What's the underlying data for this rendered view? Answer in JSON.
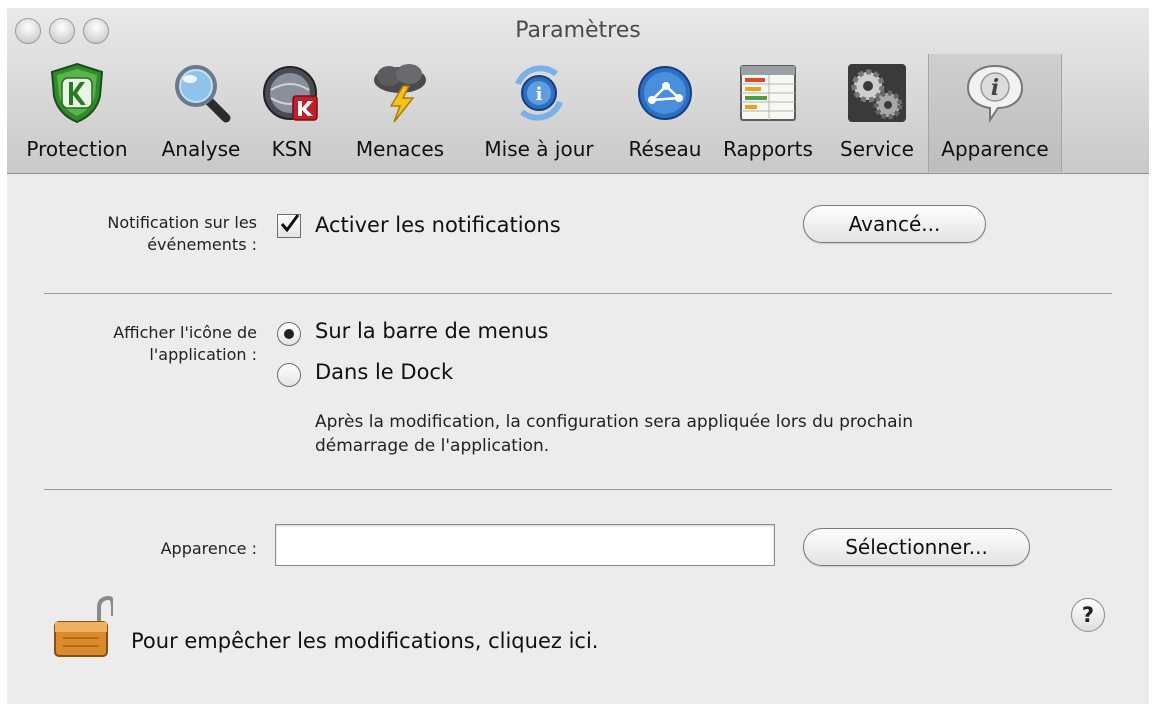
{
  "window": {
    "title": "Paramètres"
  },
  "toolbar": {
    "tabs": [
      {
        "label": "Protection",
        "icon": "shield-k-icon"
      },
      {
        "label": "Analyse",
        "icon": "magnifier-icon"
      },
      {
        "label": "KSN",
        "icon": "ksn-globe-icon"
      },
      {
        "label": "Menaces",
        "icon": "storm-cloud-icon"
      },
      {
        "label": "Mise à jour",
        "icon": "update-globe-icon"
      },
      {
        "label": "Réseau",
        "icon": "network-globe-icon"
      },
      {
        "label": "Rapports",
        "icon": "report-table-icon"
      },
      {
        "label": "Service",
        "icon": "gears-icon"
      },
      {
        "label": "Apparence",
        "icon": "info-bubble-icon"
      }
    ],
    "selected_tab": "Apparence"
  },
  "notifications": {
    "label": "Notification sur les événements :",
    "checkbox_label": "Activer les notifications",
    "checked": true,
    "advanced_button": "Avancé..."
  },
  "app_icon": {
    "label": "Afficher l'icône de l'application :",
    "options": [
      {
        "label": "Sur la barre de menus",
        "selected": true
      },
      {
        "label": "Dans le Dock",
        "selected": false
      }
    ],
    "note": "Après la modification, la configuration sera appliquée lors du prochain démarrage de l'application."
  },
  "appearance": {
    "label": "Apparence :",
    "value": "",
    "select_button": "Sélectionner..."
  },
  "lock": {
    "text": "Pour empêcher les modifications, cliquez ici.",
    "icon": "padlock-open-icon"
  },
  "help": {
    "label": "?"
  },
  "colors": {
    "window_bg": "#ececec",
    "shield_green": "#2f8a2a",
    "globe_blue": "#2a6fc4",
    "ksn_red": "#c0202a",
    "lock_orange": "#d98a2a"
  }
}
